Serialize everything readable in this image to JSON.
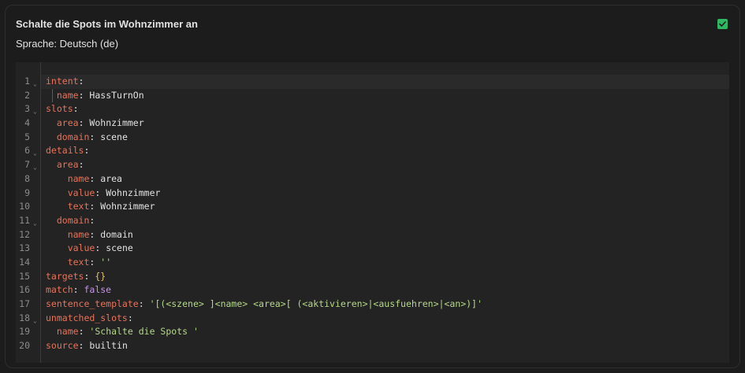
{
  "card": {
    "title": "Schalte die Spots im Wohnzimmer an",
    "language": "Sprache: Deutsch (de)",
    "checkbox_checked": true,
    "checkbox_color": "#2fb863"
  },
  "editor": {
    "line_numbers": [
      "1",
      "2",
      "3",
      "4",
      "5",
      "6",
      "7",
      "8",
      "9",
      "10",
      "11",
      "12",
      "13",
      "14",
      "15",
      "16",
      "17",
      "18",
      "19",
      "20"
    ],
    "fold_lines": [
      1,
      3,
      6,
      7,
      11,
      18
    ],
    "lines": [
      {
        "key": "intent",
        "value": ""
      },
      {
        "key": "name",
        "value": "HassTurnOn"
      },
      {
        "key": "slots",
        "value": ""
      },
      {
        "key": "area",
        "value": "Wohnzimmer"
      },
      {
        "key": "domain",
        "value": "scene"
      },
      {
        "key": "details",
        "value": ""
      },
      {
        "key": "area",
        "value": ""
      },
      {
        "key": "name",
        "value": "area"
      },
      {
        "key": "value",
        "value": "Wohnzimmer"
      },
      {
        "key": "text",
        "value": "Wohnzimmer"
      },
      {
        "key": "domain",
        "value": ""
      },
      {
        "key": "name",
        "value": "domain"
      },
      {
        "key": "value",
        "value": "scene"
      },
      {
        "key": "text",
        "value": "''"
      },
      {
        "key": "targets",
        "value": "{}"
      },
      {
        "key": "match",
        "value": "false"
      },
      {
        "key": "sentence_template",
        "value": "'[(<szene> ]<name> <area>[ (<aktivieren>|<ausfuehren>|<an>)]'"
      },
      {
        "key": "unmatched_slots",
        "value": ""
      },
      {
        "key": "name",
        "value": "'Schalte die Spots '"
      },
      {
        "key": "source",
        "value": "builtin"
      }
    ]
  }
}
